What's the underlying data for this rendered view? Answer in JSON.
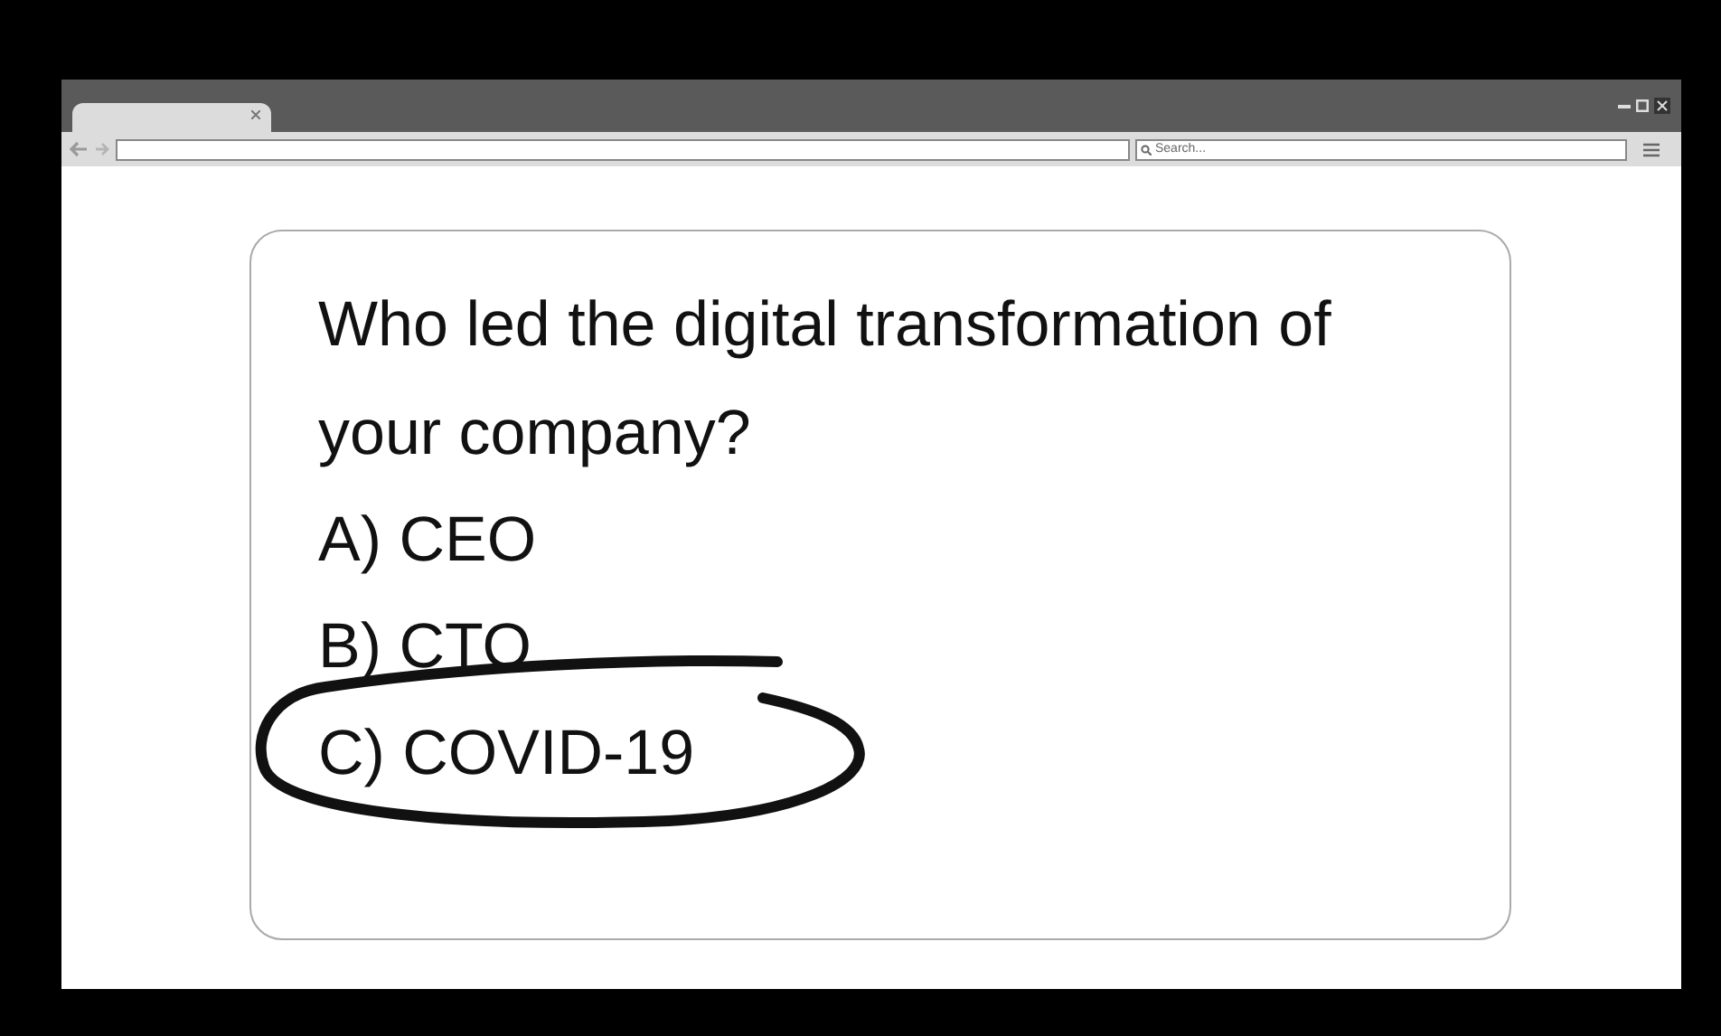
{
  "browser": {
    "search": {
      "placeholder": "Search..."
    }
  },
  "quiz": {
    "question": "Who led the digital transformation of your company?",
    "options": [
      {
        "label": "A) CEO",
        "circled": false
      },
      {
        "label": "B) CTO",
        "circled": false
      },
      {
        "label": "C) COVID-19",
        "circled": true
      }
    ]
  }
}
